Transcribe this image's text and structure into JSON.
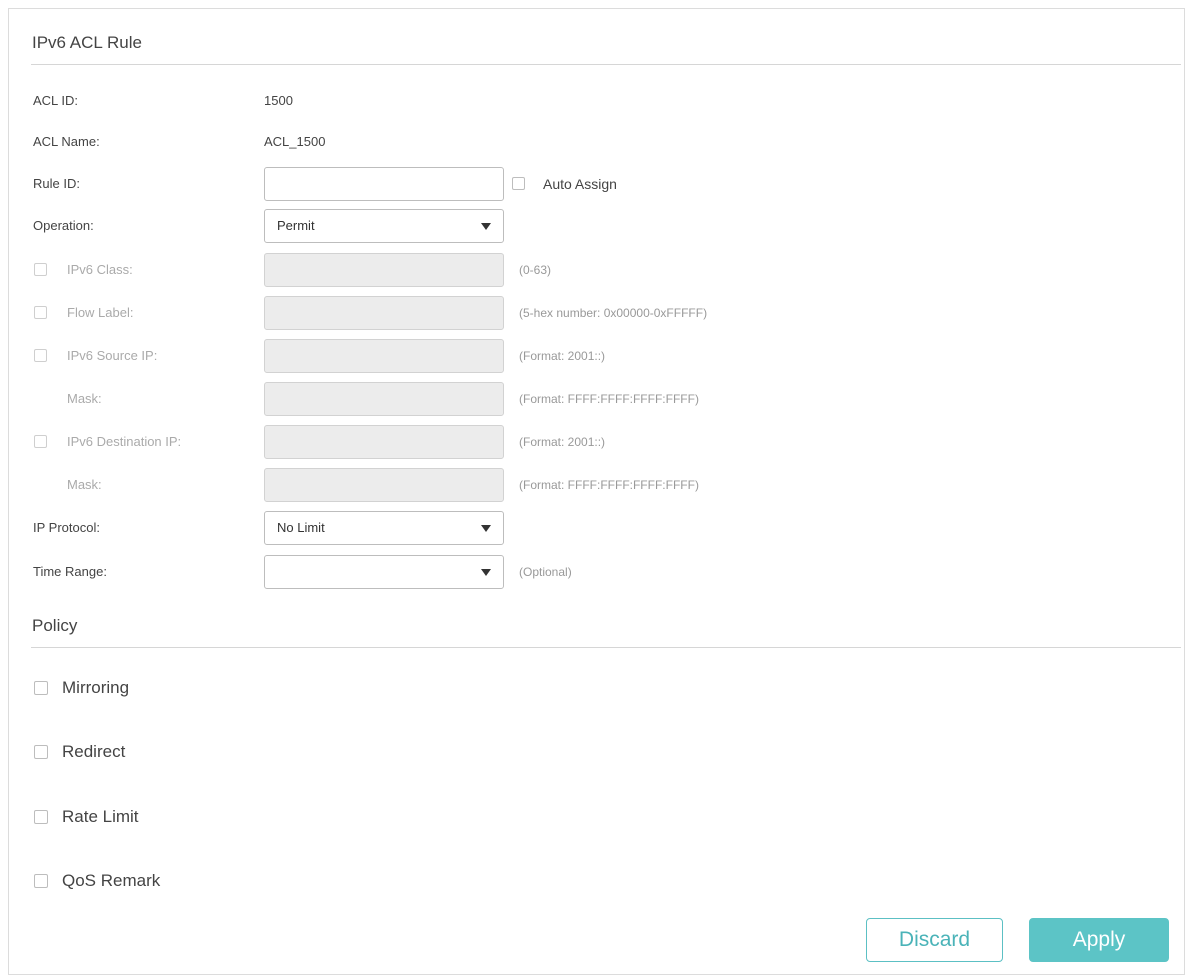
{
  "section_rule": {
    "title": "IPv6 ACL Rule"
  },
  "acl_id": {
    "label": "ACL ID:",
    "value": "1500"
  },
  "acl_name": {
    "label": "ACL Name:",
    "value": "ACL_1500"
  },
  "rule_id": {
    "label": "Rule ID:",
    "value": "",
    "auto_assign_label": "Auto Assign"
  },
  "operation": {
    "label": "Operation:",
    "value": "Permit"
  },
  "ipv6_class": {
    "label": "IPv6 Class:",
    "value": "",
    "hint": "(0-63)"
  },
  "flow_label": {
    "label": "Flow Label:",
    "value": "",
    "hint": "(5-hex number: 0x00000-0xFFFFF)"
  },
  "source_ip": {
    "label": "IPv6 Source IP:",
    "value": "",
    "hint": "(Format: 2001::)"
  },
  "source_mask": {
    "label": "Mask:",
    "value": "",
    "hint": "(Format: FFFF:FFFF:FFFF:FFFF)"
  },
  "dest_ip": {
    "label": "IPv6 Destination IP:",
    "value": "",
    "hint": "(Format: 2001::)"
  },
  "dest_mask": {
    "label": "Mask:",
    "value": "",
    "hint": "(Format: FFFF:FFFF:FFFF:FFFF)"
  },
  "ip_protocol": {
    "label": "IP Protocol:",
    "value": "No Limit"
  },
  "time_range": {
    "label": "Time Range:",
    "value": "",
    "hint": "(Optional)"
  },
  "section_policy": {
    "title": "Policy"
  },
  "policy": {
    "mirroring": "Mirroring",
    "redirect": "Redirect",
    "rate_limit": "Rate Limit",
    "qos_remark": "QoS Remark"
  },
  "buttons": {
    "discard": "Discard",
    "apply": "Apply"
  },
  "colors": {
    "accent": "#5cc4c6",
    "disabled_field": "#ececec",
    "hint_text": "#999999"
  }
}
